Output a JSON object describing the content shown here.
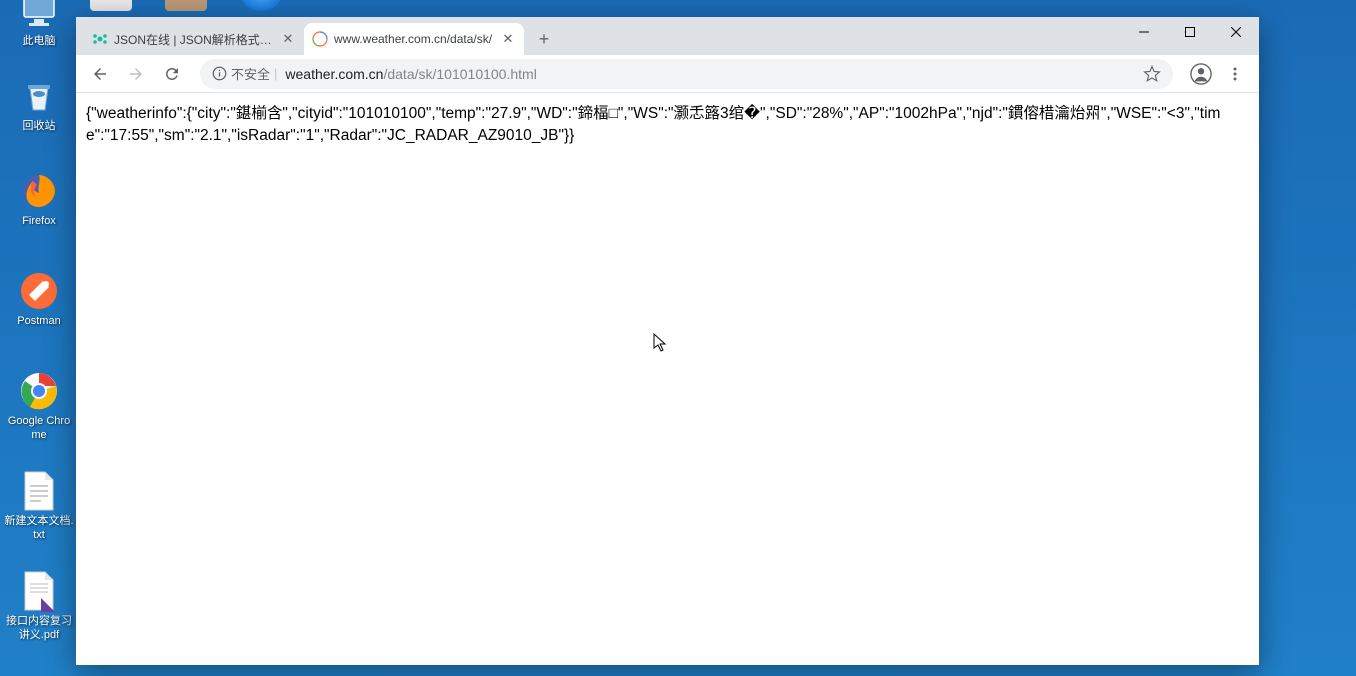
{
  "desktop": {
    "icons": [
      {
        "label": "此电脑"
      },
      {
        "label": "回收站"
      },
      {
        "label": "Firefox"
      },
      {
        "label": "Postman"
      },
      {
        "label": "Google Chrome"
      },
      {
        "label": "新建文本文档.txt"
      },
      {
        "label": "接口内容复习讲义.pdf"
      }
    ]
  },
  "browser": {
    "tabs": [
      {
        "title": "JSON在线 | JSON解析格式化—S"
      },
      {
        "title": "www.weather.com.cn/data/sk/"
      }
    ],
    "security_text": "不安全",
    "url_host": "weather.com.cn",
    "url_path": "/data/sk/101010100.html",
    "content": "{\"weatherinfo\":{\"city\":\"鍖椾含\",\"cityid\":\"101010100\",\"temp\":\"27.9\",\"WD\":\"鍗楅□\",\"WS\":\"灏忎簬3绾�\",\"SD\":\"28%\",\"AP\":\"1002hPa\",\"njd\":\"鏆傛棤瀹炲喌\",\"WSE\":\"<3\",\"time\":\"17:55\",\"sm\":\"2.1\",\"isRadar\":\"1\",\"Radar\":\"JC_RADAR_AZ9010_JB\"}}"
  }
}
